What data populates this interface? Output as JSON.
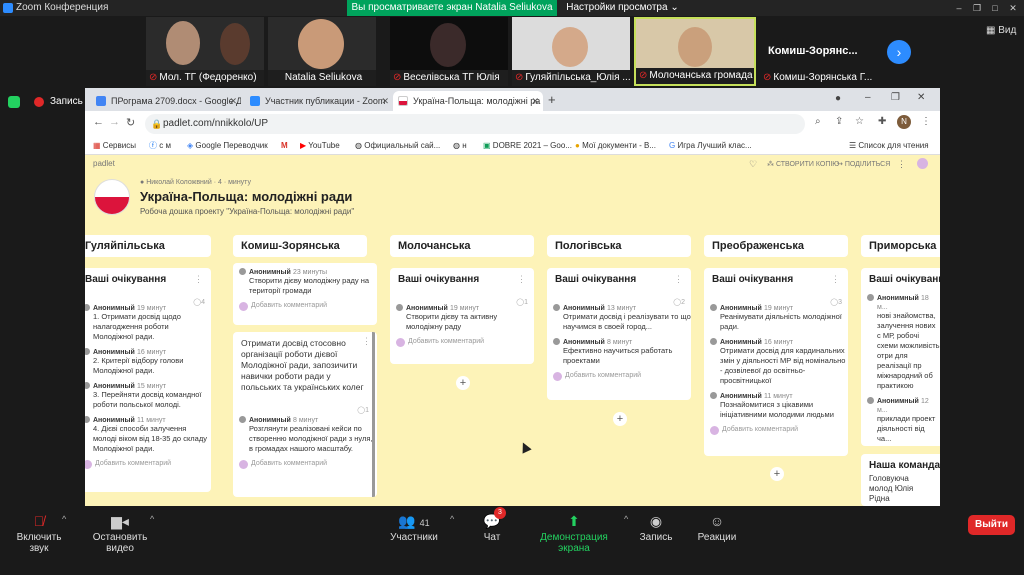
{
  "window": {
    "app_title": "Zoom Конференция",
    "share_banner": "Вы просматриваете экран Natalia Seliukova",
    "view_options": "Настройки просмотра",
    "view_button": "Вид"
  },
  "participants": [
    {
      "name": "Мол. ТГ (Федоренко)",
      "muted": true
    },
    {
      "name": "Natalia Seliukova",
      "muted": false
    },
    {
      "name": "Веселівська ТГ Юлія",
      "muted": true
    },
    {
      "name": "Гуляйпільська_Юлія ...",
      "muted": true
    },
    {
      "name": "Молочанська громада ...",
      "muted": true
    },
    {
      "name": "Комиш-Зорянська Г...",
      "muted": true
    }
  ],
  "participant_name_only": "Комиш-Зорянс...",
  "recording": {
    "label": "Запись"
  },
  "browser": {
    "tabs": [
      {
        "label": "ПРограма 2709.docx - Google Д",
        "color": "#4285f4"
      },
      {
        "label": "Участник публикации - Zoom",
        "color": "#2d8cff"
      },
      {
        "label": "Україна-Польща: молодіжні ра",
        "color": "#ffffff"
      }
    ],
    "url": "padlet.com/nnikkolo/UP",
    "profile_letter": "N",
    "bookmarks": [
      "Сервисы",
      "с м",
      "Google Переводчик",
      "M",
      "YouTube",
      "Официальный сай...",
      "н",
      "DOBRE 2021 – Goo...",
      "Мої документи - В...",
      "Игра Лучший клас...",
      "Список для чтения"
    ]
  },
  "padlet": {
    "brand": "padlet",
    "remake": "СТВОРИТИ КОПІЮ",
    "share": "ПОДІЛИТЬСЯ",
    "author": "Николай Коложвний",
    "time": "4 · минуту",
    "title": "Україна-Польща: молодіжні ради",
    "subtitle": "Робоча дошка проекту \"Україна-Польща: молодіжні ради\"",
    "add_comment": "Добавить комментарий",
    "columns": [
      {
        "name": "Гуляйпільська",
        "card_title": "Ваші очікування",
        "count": "4",
        "comments": [
          {
            "author": "Анонимный",
            "time": "19 минут",
            "text": "1. Отримати досвід щодо налагодження роботи Молодіжної ради."
          },
          {
            "author": "Анонимный",
            "time": "16 минут",
            "text": "2. Критерії відбору голови Молодіжної ради."
          },
          {
            "author": "Анонимный",
            "time": "15 минут",
            "text": "3. Перейняти досвід командної роботи польської молоді."
          },
          {
            "author": "Анонимный",
            "time": "11 минут",
            "text": "4. Дієві способи залучення молоді віком від 18-35 до складу Молодіжної ради."
          }
        ]
      },
      {
        "name": "Комиш-Зорянська",
        "card_title": "",
        "count": "1",
        "comments": [
          {
            "author": "Анонимный",
            "time": "23 минуты",
            "text": "Створити дієву молодіжну раду на території громади"
          }
        ],
        "card2_text": "Отримати досвід стосовно організації роботи дієвої Молодіжної ради, запозичити навички роботи ради у польських та українських колег",
        "card2_comment": {
          "author": "Анонимный",
          "time": "8 минут",
          "text": "Розглянути реалізовані кейси по створенню молодіжної ради з нуля, в громадах нашого масштабу."
        }
      },
      {
        "name": "Молочанська",
        "card_title": "Ваші очікування",
        "count": "1",
        "comments": [
          {
            "author": "Анонимный",
            "time": "19 минут",
            "text": "Створити дієву та активну молодіжну раду"
          }
        ]
      },
      {
        "name": "Пологівська",
        "card_title": "Ваші очікування",
        "count": "2",
        "comments": [
          {
            "author": "Анонимный",
            "time": "13 минут",
            "text": "Отримати досвід і реалізувати то що научимся в своей город..."
          },
          {
            "author": "Анонимный",
            "time": "8 минут",
            "text": "Ефективно научиться работать проектами"
          }
        ]
      },
      {
        "name": "Преображенська",
        "card_title": "Ваші очікування",
        "count": "3",
        "comments": [
          {
            "author": "Анонимный",
            "time": "19 минут",
            "text": "Реанімувати діяльність молодіжної ради."
          },
          {
            "author": "Анонимный",
            "time": "16 минут",
            "text": "Отримати досвід для кардинальних змін у діяльності МР від номінально - дозвілевої до освітньо-просвітницької"
          },
          {
            "author": "Анонимный",
            "time": "11 минут",
            "text": "Познайомитися з цікавими ініціативними молодими людьми"
          }
        ]
      },
      {
        "name": "Приморська",
        "card_title": "Ваші очікування",
        "count": "",
        "comments": [
          {
            "author": "Анонимный",
            "time": "18 м...",
            "text": "нові знайомства, залучення нових с МР, робочі схеми можливість отри для реалізації пр міжнародний об практикою"
          },
          {
            "author": "Анонимный",
            "time": "12 м...",
            "text": "приклади проект діяльності від ча..."
          }
        ],
        "card2_title": "Наша команда",
        "card2_text": "Головуюча молод Юлія Рідна"
      }
    ]
  },
  "toolbar": {
    "mute": "Включить звук",
    "video": "Остановить видео",
    "participants": "Участники",
    "participants_count": "41",
    "chat": "Чат",
    "chat_badge": "3",
    "share": "Демонстрация экрана",
    "record": "Запись",
    "reactions": "Реакции",
    "leave": "Выйти"
  },
  "colors": {
    "zoom_blue": "#2d8cff",
    "share_green": "#00a35c",
    "leave_red": "#e02828",
    "padlet_bg": "#fdf3b8"
  }
}
